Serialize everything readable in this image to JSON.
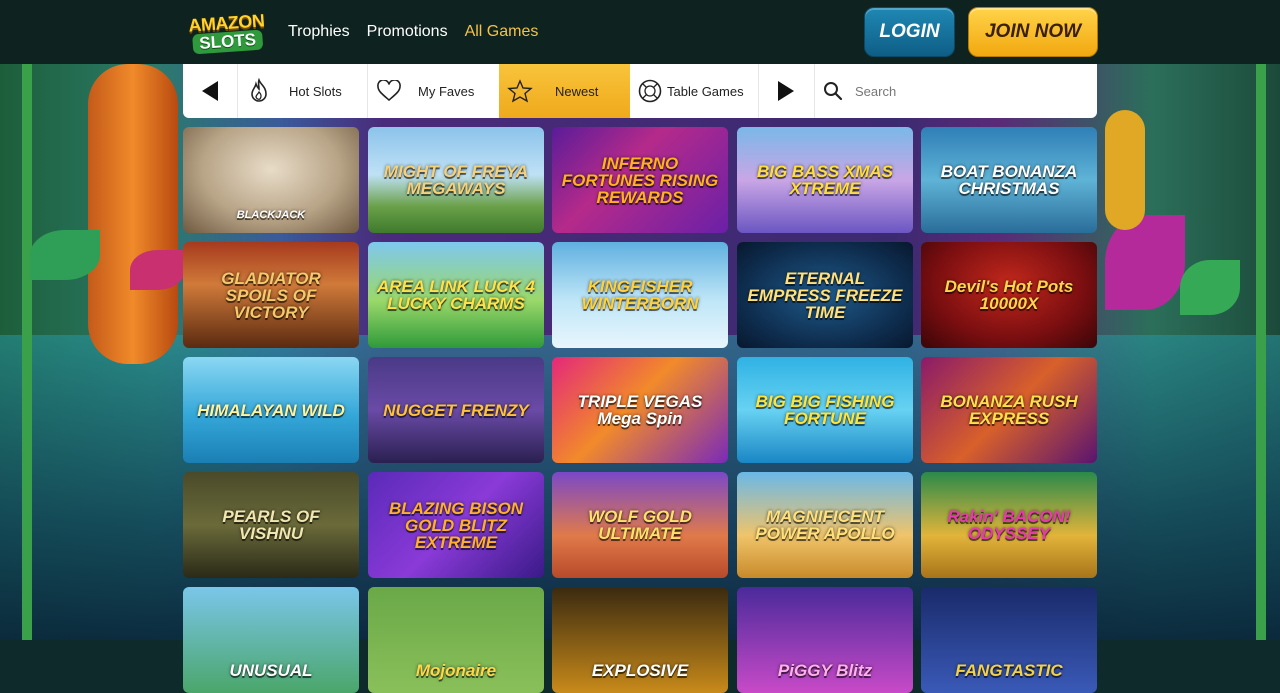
{
  "brand": {
    "logo_top": "AMAZON",
    "logo_bottom": "SLOTS"
  },
  "nav": {
    "items": [
      "Trophies",
      "Promotions",
      "All Games"
    ],
    "active": "All Games"
  },
  "auth": {
    "login_label": "LOGIN",
    "join_label": "JOIN NOW"
  },
  "filters": {
    "hot_slots": "Hot Slots",
    "my_faves": "My Faves",
    "newest": "Newest",
    "table_games": "Table Games",
    "selected": "Newest"
  },
  "search": {
    "placeholder": "Search",
    "value": ""
  },
  "colors": {
    "header_bg": "#0e2320",
    "accent": "#f5c242",
    "login": "#1f88b4",
    "join": "#f2a80f"
  },
  "games": [
    {
      "title": "BLACKJACK",
      "theme": "blackjack"
    },
    {
      "title": "MIGHT OF FREYA MEGAWAYS",
      "theme": "freya"
    },
    {
      "title": "INFERNO FORTUNES RISING REWARDS",
      "theme": "inferno"
    },
    {
      "title": "BIG BASS XMAS XTREME",
      "theme": "bigbass"
    },
    {
      "title": "BOAT BONANZA CHRISTMAS",
      "theme": "boat"
    },
    {
      "title": "GLADIATOR SPOILS OF VICTORY",
      "theme": "gladiator"
    },
    {
      "title": "AREA LINK LUCK 4 LUCKY CHARMS",
      "theme": "luck"
    },
    {
      "title": "KINGFISHER WINTERBORN",
      "theme": "kingfisher"
    },
    {
      "title": "ETERNAL EMPRESS FREEZE TIME",
      "theme": "empress"
    },
    {
      "title": "Devil's Hot Pots 10000X",
      "theme": "devils"
    },
    {
      "title": "HIMALAYAN WILD",
      "theme": "himalayan"
    },
    {
      "title": "NUGGET FRENZY",
      "theme": "nugget"
    },
    {
      "title": "TRIPLE VEGAS Mega Spin",
      "theme": "vegas"
    },
    {
      "title": "BIG BIG FISHING FORTUNE",
      "theme": "fishing"
    },
    {
      "title": "BONANZA RUSH EXPRESS",
      "theme": "bonanza"
    },
    {
      "title": "PEARLS OF VISHNU",
      "theme": "pearls"
    },
    {
      "title": "BLAZING BISON GOLD BLITZ EXTREME",
      "theme": "bison"
    },
    {
      "title": "WOLF GOLD ULTIMATE",
      "theme": "wolf"
    },
    {
      "title": "MAGNIFICENT POWER APOLLO",
      "theme": "apollo"
    },
    {
      "title": "Rakin' BACON! ODYSSEY",
      "theme": "bacon"
    },
    {
      "title": "UNUSUAL",
      "theme": "unusual"
    },
    {
      "title": "Mojonaire",
      "theme": "mojonaire"
    },
    {
      "title": "EXPLOSIVE",
      "theme": "explosive"
    },
    {
      "title": "PiGGY Blitz",
      "theme": "piggy"
    },
    {
      "title": "FANGTASTIC",
      "theme": "fangtastic"
    }
  ]
}
